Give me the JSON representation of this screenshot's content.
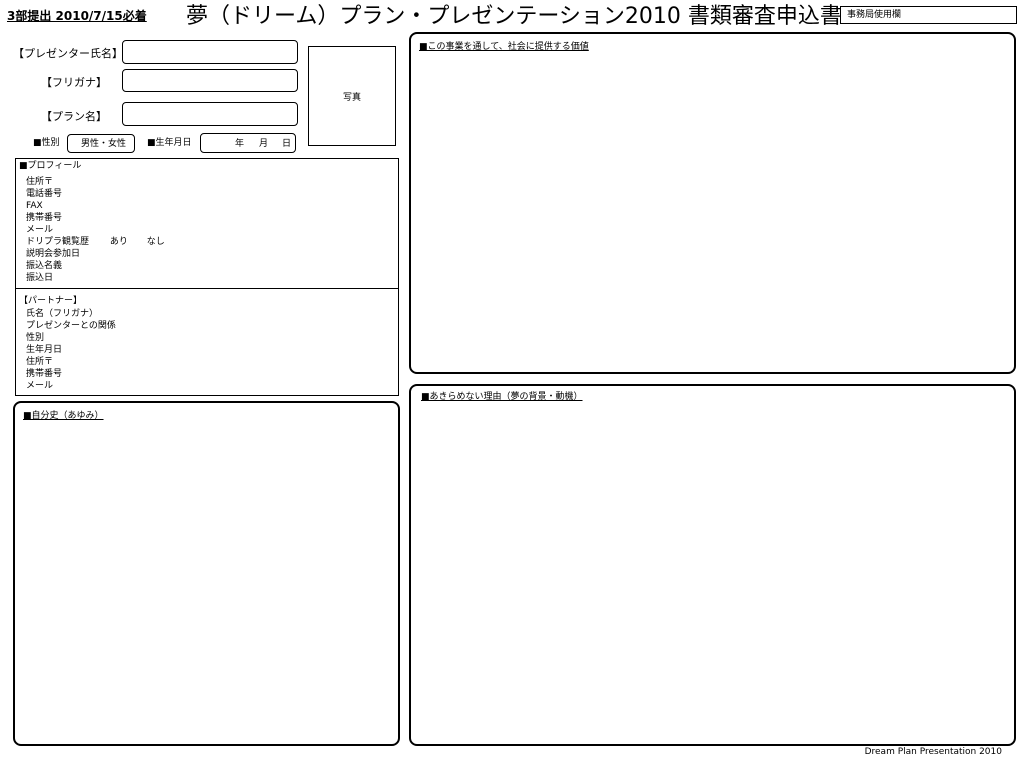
{
  "header": {
    "deadline": "3部提出  2010/7/15必着",
    "title": "夢（ドリーム）プラン・プレゼンテーション2010 書類審査申込書",
    "office_use": "事務局使用欄"
  },
  "form": {
    "presenter_name_label": "【プレゼンター氏名】",
    "furigana_label": "【フリガナ】",
    "plan_name_label": "【プラン名】",
    "photo_label": "写真",
    "gender_label": "■性別",
    "gender_value": "男性・女性",
    "birthdate_label": "■生年月日",
    "birthdate_year": "年",
    "birthdate_month": "月",
    "birthdate_day": "日"
  },
  "profile": {
    "title": "■プロフィール",
    "items": [
      "住所〒",
      "電話番号",
      "FAX",
      "携帯番号",
      "メール",
      "ドリプラ観覧歴",
      "説明会参加日",
      "振込名義",
      "振込日"
    ],
    "attendance_yes": "あり",
    "attendance_no": "なし"
  },
  "partner": {
    "title": "【パートナー】",
    "items": [
      "氏名（フリガナ）",
      "プレゼンターとの関係",
      "性別",
      "生年月日",
      "住所〒",
      "携帯番号",
      "メール"
    ]
  },
  "history": {
    "title": "■自分史（あゆみ）"
  },
  "value": {
    "title": "■この事業を通して、社会に提供する価値"
  },
  "reason": {
    "title": "■あきらめない理由（夢の背景・動機）"
  },
  "footer": {
    "text": "Dream Plan Presentation 2010"
  }
}
